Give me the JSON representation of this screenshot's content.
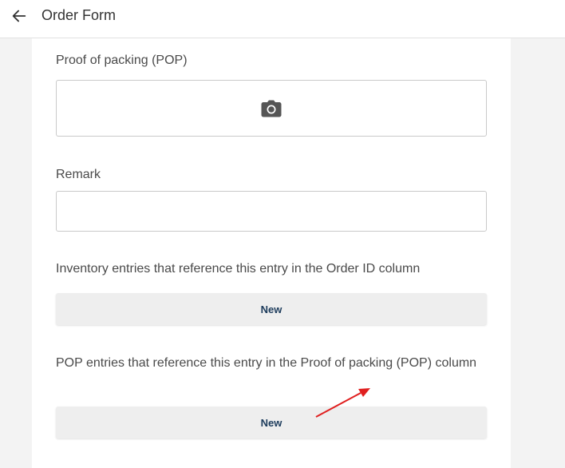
{
  "header": {
    "title": "Order Form",
    "back_icon": "arrow-left-icon"
  },
  "form": {
    "pop_label": "Proof of packing (POP)",
    "pop_icon": "camera-icon",
    "remark_label": "Remark",
    "remark_value": "",
    "inventory_label": "Inventory entries that reference this entry in the Order ID column",
    "inventory_button": "New",
    "pop_entries_label": "POP entries that reference this entry in the Proof of packing (POP) column",
    "pop_entries_button": "New"
  },
  "annotation": {
    "arrow_color": "#e02020"
  }
}
